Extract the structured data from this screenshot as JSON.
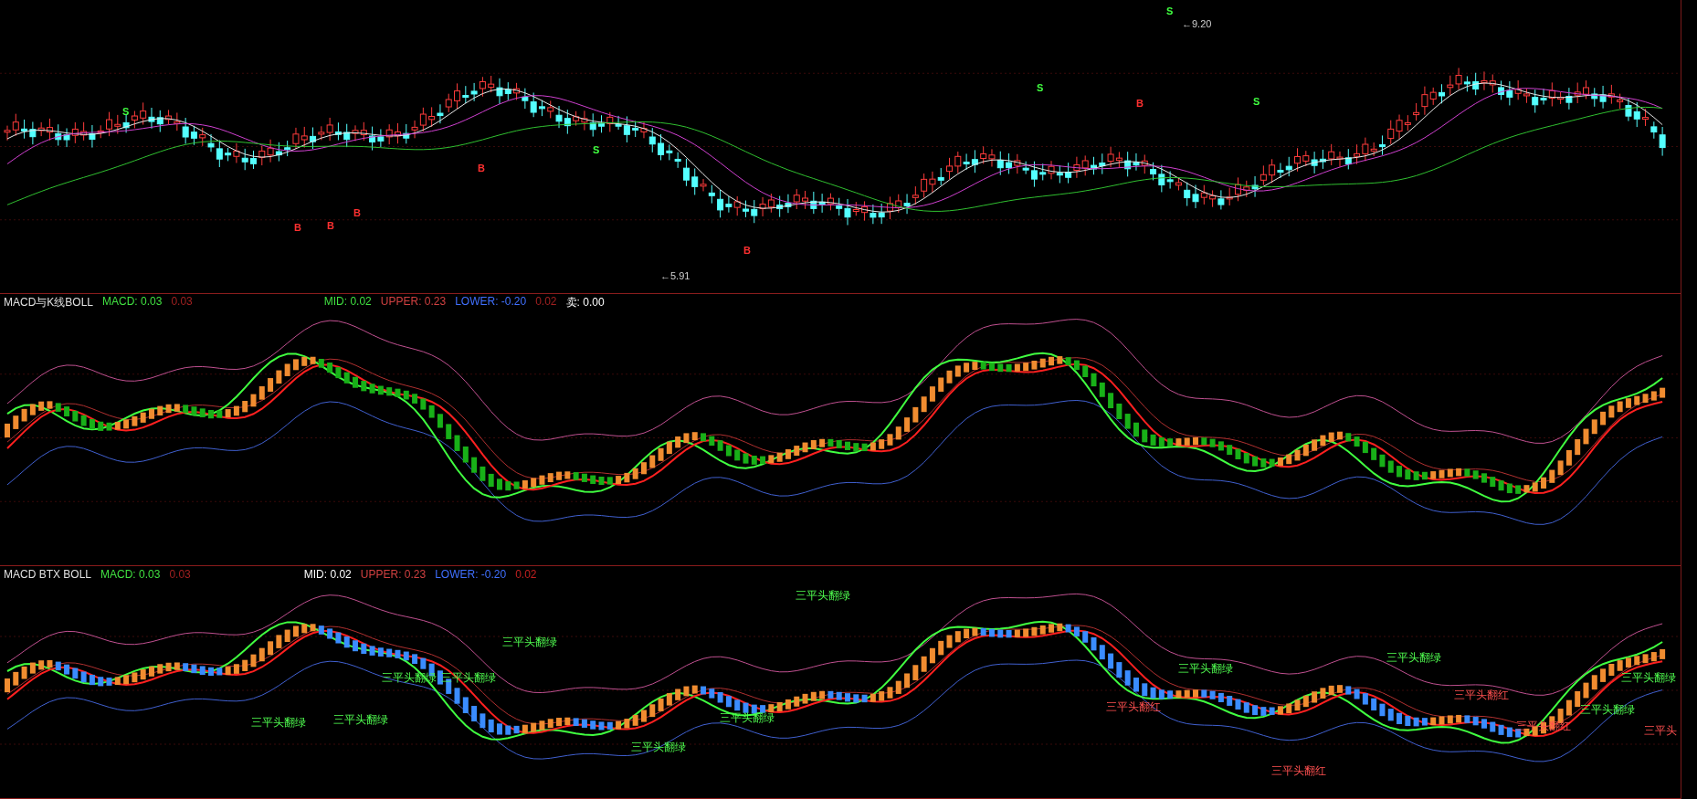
{
  "price_panel": {
    "signals": [
      {
        "text": "S",
        "kind": "sell"
      },
      {
        "text": "S",
        "kind": "sell"
      },
      {
        "text": "S",
        "kind": "sell"
      },
      {
        "text": "S",
        "kind": "sell"
      },
      {
        "text": "S",
        "kind": "sell"
      },
      {
        "text": "B",
        "kind": "buy"
      },
      {
        "text": "B",
        "kind": "buy"
      },
      {
        "text": "B",
        "kind": "buy"
      },
      {
        "text": "B",
        "kind": "buy"
      },
      {
        "text": "B",
        "kind": "buy"
      },
      {
        "text": "B",
        "kind": "buy"
      }
    ],
    "price_labels": [
      "←9.20",
      "←5.91"
    ]
  },
  "indicator_panels": [
    {
      "header_left": [
        {
          "text": "MACD与K线BOLL",
          "color": "#e0e0e0"
        },
        {
          "text": "MACD: 0.03",
          "color": "#40e040"
        },
        {
          "text": "0.03",
          "color": "#a02020"
        }
      ],
      "header_right": [
        {
          "text": "MID: 0.02",
          "color": "#40e040"
        },
        {
          "text": "UPPER: 0.23",
          "color": "#d04040"
        },
        {
          "text": "LOWER: -0.20",
          "color": "#4070ff"
        },
        {
          "text": "0.02",
          "color": "#a02020"
        },
        {
          "text": "卖: 0.00",
          "color": "#ffffff"
        }
      ]
    },
    {
      "header_left": [
        {
          "text": "MACD BTX BOLL",
          "color": "#e0e0e0"
        },
        {
          "text": "MACD: 0.03",
          "color": "#40e040"
        },
        {
          "text": "0.03",
          "color": "#a02020"
        }
      ],
      "header_right": [
        {
          "text": "MID: 0.02",
          "color": "#ffffff"
        },
        {
          "text": "UPPER: 0.23",
          "color": "#d04040"
        },
        {
          "text": "LOWER: -0.20",
          "color": "#4070ff"
        },
        {
          "text": "0.02",
          "color": "#c02020"
        }
      ],
      "patterns": [
        {
          "text": "三平头翻绿",
          "kind": "green"
        },
        {
          "text": "三平头翻绿",
          "kind": "green"
        },
        {
          "text": "三平头翻绿",
          "kind": "green"
        },
        {
          "text": "三平头翻绿",
          "kind": "green"
        },
        {
          "text": "三平头翻绿",
          "kind": "green"
        },
        {
          "text": "三平头翻绿",
          "kind": "green"
        },
        {
          "text": "三平头翻绿",
          "kind": "green"
        },
        {
          "text": "三平头翻绿",
          "kind": "green"
        },
        {
          "text": "三平头翻绿",
          "kind": "green"
        },
        {
          "text": "三平头翻绿",
          "kind": "green"
        },
        {
          "text": "三平头翻绿",
          "kind": "green"
        },
        {
          "text": "三平头翻绿",
          "kind": "green"
        },
        {
          "text": "三平头翻红",
          "kind": "red"
        },
        {
          "text": "三平头翻红",
          "kind": "red"
        },
        {
          "text": "三平头翻红",
          "kind": "red"
        },
        {
          "text": "三平头翻红",
          "kind": "red"
        },
        {
          "text": "三平头",
          "kind": "red"
        }
      ]
    }
  ]
}
